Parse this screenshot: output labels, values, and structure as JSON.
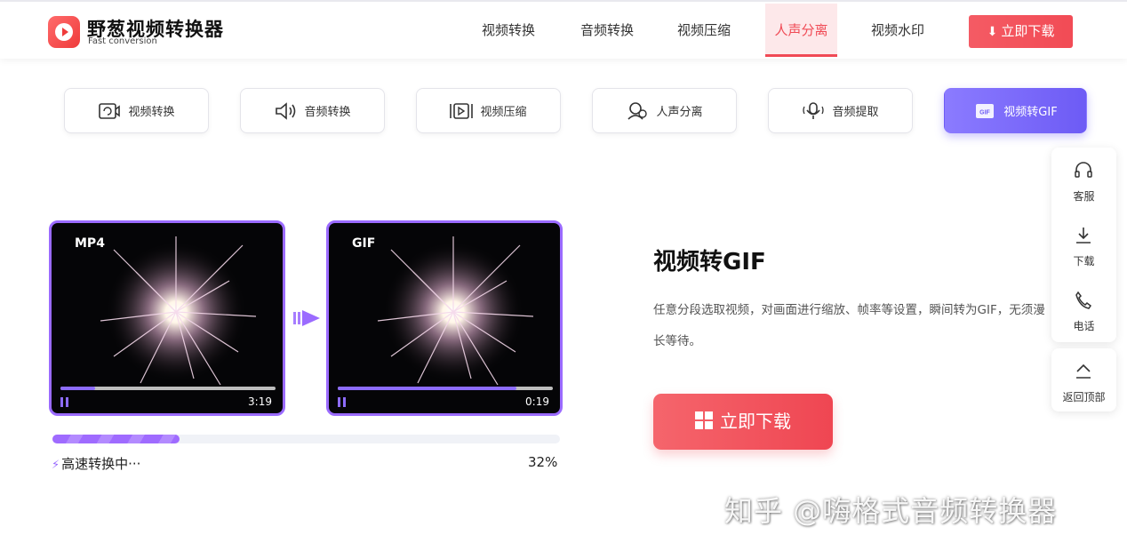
{
  "header": {
    "logo_title": "野葱视频转换器",
    "logo_subtitle": "Fast conversion",
    "nav": [
      "视频转换",
      "音频转换",
      "视频压缩",
      "人声分离",
      "视频水印"
    ],
    "active_nav": "人声分离",
    "download_button": "立即下载"
  },
  "tools": [
    {
      "label": "视频转换",
      "icon": "video-convert-icon"
    },
    {
      "label": "音频转换",
      "icon": "audio-convert-icon"
    },
    {
      "label": "视频压缩",
      "icon": "video-compress-icon"
    },
    {
      "label": "人声分离",
      "icon": "voice-separate-icon"
    },
    {
      "label": "音频提取",
      "icon": "audio-extract-icon"
    },
    {
      "label": "视频转GIF",
      "icon": "gif-icon"
    }
  ],
  "active_tool": "视频转GIF",
  "preview": {
    "source": {
      "tag": "MP4",
      "time": "3:19",
      "progress": 0.16
    },
    "target": {
      "tag": "GIF",
      "time": "0:19",
      "progress": 0.83
    }
  },
  "conversion": {
    "status": "高速转换中···",
    "percent_label": "32%",
    "progress": 0.25
  },
  "feature": {
    "title": "视频转GIF",
    "description": "任意分段选取视频，对画面进行缩放、帧率等设置，瞬间转为GIF，无须漫长等待。",
    "button": "立即下载"
  },
  "floating": {
    "service": "客服",
    "download": "下载",
    "phone": "电话",
    "back_top": "返回顶部"
  },
  "watermark": "知乎 @嗨格式音频转换器",
  "colors": {
    "brand_red": "#f24b55",
    "purple": "#9b6bff"
  }
}
